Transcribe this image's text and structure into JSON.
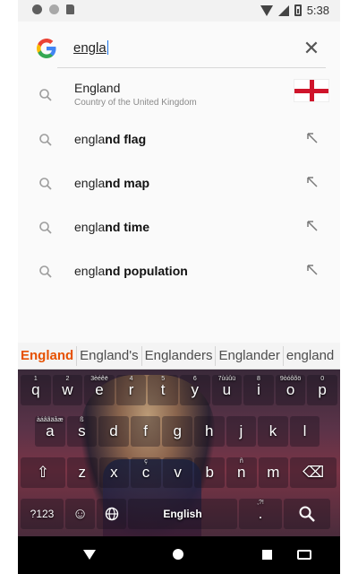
{
  "status_bar": {
    "time": "5:38"
  },
  "search": {
    "query": "engla",
    "clear_icon": "close-icon"
  },
  "suggestions": [
    {
      "typed": "",
      "rest": "England",
      "subtitle": "Country of the United Kingdom",
      "type": "entity"
    },
    {
      "typed": "engla",
      "rest": "nd flag",
      "type": "query"
    },
    {
      "typed": "engla",
      "rest": "nd map",
      "type": "query"
    },
    {
      "typed": "engla",
      "rest": "nd time",
      "type": "query"
    },
    {
      "typed": "engla",
      "rest": "nd population",
      "type": "query"
    }
  ],
  "keyboard": {
    "candidates": [
      "England",
      "England's",
      "Englanders",
      "Englander",
      "england"
    ],
    "row1": [
      {
        "label": "q",
        "hint": "1"
      },
      {
        "label": "w",
        "hint": "2"
      },
      {
        "label": "e",
        "hint": "3èéêë"
      },
      {
        "label": "r",
        "hint": "4"
      },
      {
        "label": "t",
        "hint": "5"
      },
      {
        "label": "y",
        "hint": "6"
      },
      {
        "label": "u",
        "hint": "7ùúûü"
      },
      {
        "label": "i",
        "hint": "8"
      },
      {
        "label": "o",
        "hint": "9òóôõö"
      },
      {
        "label": "p",
        "hint": "0"
      }
    ],
    "row2": [
      {
        "label": "a",
        "hint": "àáâãäåæ"
      },
      {
        "label": "s",
        "hint": "ß"
      },
      {
        "label": "d",
        "hint": ""
      },
      {
        "label": "f",
        "hint": ""
      },
      {
        "label": "g",
        "hint": ""
      },
      {
        "label": "h",
        "hint": ""
      },
      {
        "label": "j",
        "hint": ""
      },
      {
        "label": "k",
        "hint": ""
      },
      {
        "label": "l",
        "hint": ""
      }
    ],
    "row3": [
      {
        "label": "z",
        "hint": ""
      },
      {
        "label": "x",
        "hint": ""
      },
      {
        "label": "c",
        "hint": "ç"
      },
      {
        "label": "v",
        "hint": ""
      },
      {
        "label": "b",
        "hint": ""
      },
      {
        "label": "n",
        "hint": "ñ"
      },
      {
        "label": "m",
        "hint": ""
      }
    ],
    "sym_label": "?123",
    "space_label": "English",
    "period_label": ".",
    "period_hint": ",?!",
    "shift_icon": "shift-icon",
    "backspace_icon": "backspace-icon",
    "emoji_icon": "emoji-icon",
    "globe_icon": "globe-icon",
    "search_action_icon": "search-icon"
  },
  "colors": {
    "google_blue": "#4285F4",
    "google_red": "#EA4335",
    "google_yellow": "#FBBC05",
    "google_green": "#34A853",
    "candidate_primary": "#e65100",
    "flag_red": "#cf142b"
  }
}
